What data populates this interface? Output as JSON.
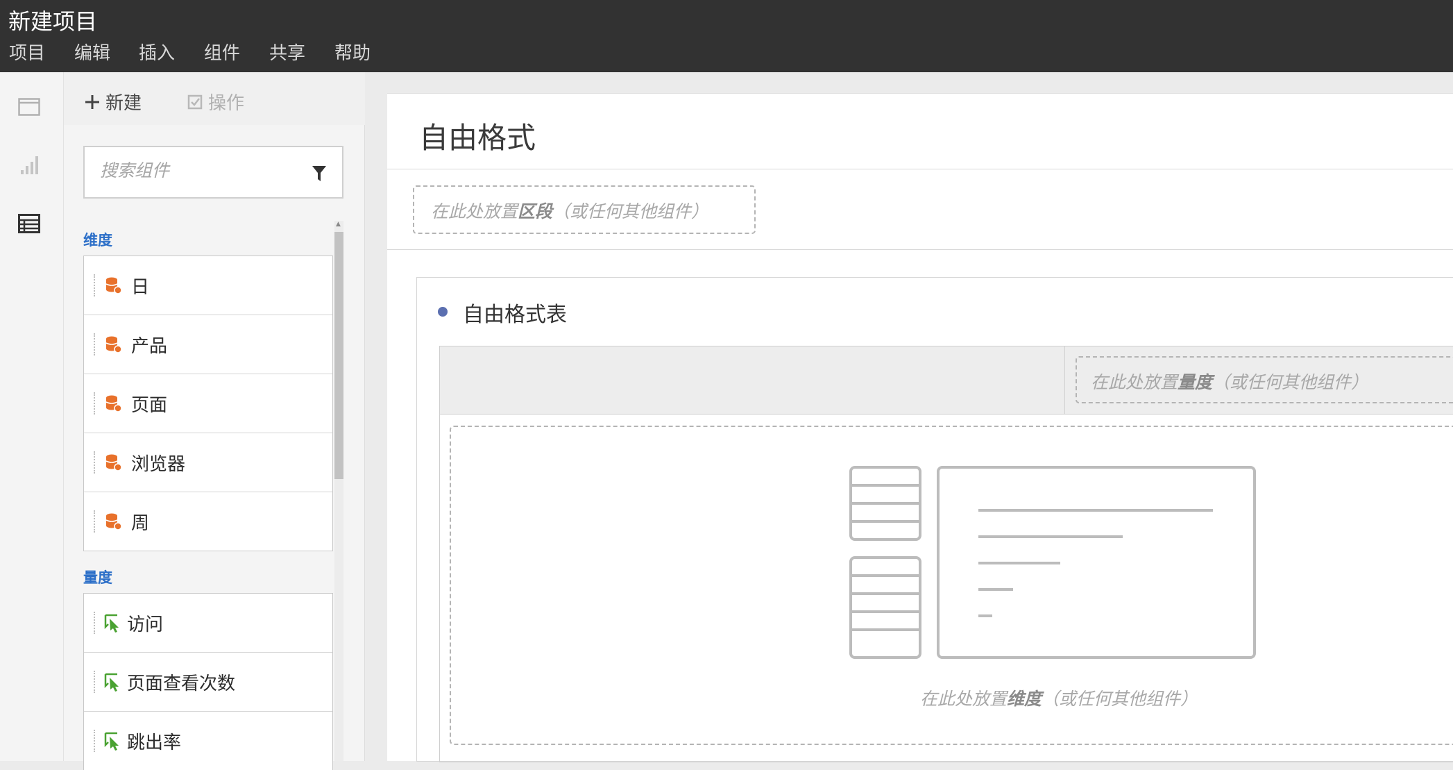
{
  "app": {
    "title": "新建项目"
  },
  "menu": [
    "项目",
    "编辑",
    "插入",
    "组件",
    "共享",
    "帮助"
  ],
  "rail": {
    "items": [
      {
        "icon": "panel-icon",
        "active": false
      },
      {
        "icon": "visualization-icon",
        "active": false
      },
      {
        "icon": "components-icon",
        "active": true
      }
    ]
  },
  "panel_toolbar": {
    "new_label": "新建",
    "actions_label": "操作"
  },
  "search": {
    "placeholder": "搜索组件"
  },
  "dimensions": {
    "label": "维度",
    "items": [
      "日",
      "产品",
      "页面",
      "浏览器",
      "周"
    ],
    "icon": "dimension-icon",
    "icon_color": "#e8712b"
  },
  "metrics": {
    "label": "量度",
    "items": [
      "访问",
      "页面查看次数",
      "跳出率"
    ],
    "icon": "metric-icon",
    "icon_color": "#4aa232"
  },
  "canvas": {
    "title": "自由格式",
    "segment_drop": {
      "prefix": "在此处放置",
      "emph": "区段",
      "suffix": "（或任何其他组件）"
    }
  },
  "freeform_panel": {
    "title": "自由格式表",
    "metric_drop": {
      "prefix": "在此处放置",
      "emph": "量度",
      "suffix": "（或任何其他组件）"
    },
    "dimension_drop": {
      "prefix": "在此处放置",
      "emph": "维度",
      "suffix": "（或任何其他组件）"
    }
  },
  "colors": {
    "topbar": "#323232",
    "accent_label": "#2c6fc8",
    "panel_dot": "#5b6fb0"
  }
}
